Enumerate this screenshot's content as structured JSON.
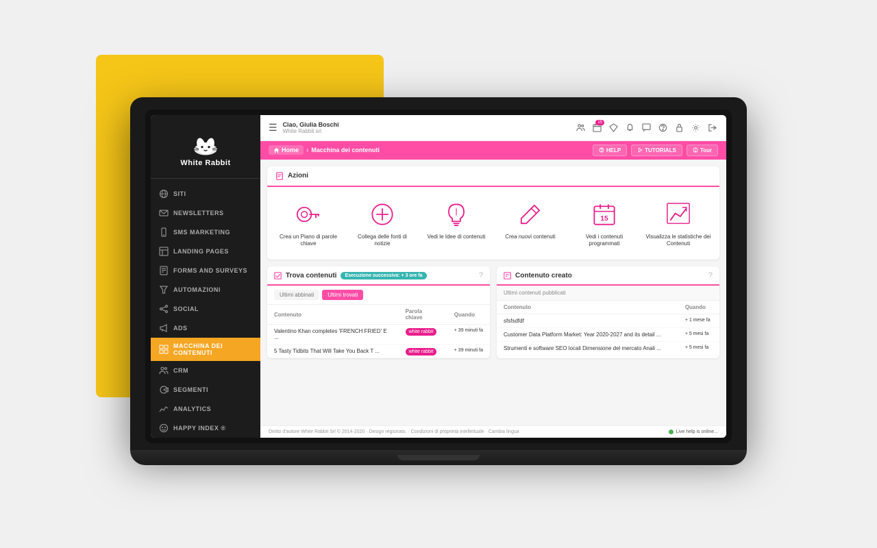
{
  "scene": {
    "yellow_bg": true
  },
  "sidebar": {
    "logo_text": "White Rabbit",
    "nav_items": [
      {
        "id": "siti",
        "label": "SITI",
        "icon": "globe"
      },
      {
        "id": "newsletters",
        "label": "NEWSLETTERS",
        "icon": "envelope"
      },
      {
        "id": "sms-marketing",
        "label": "SMS MARKETING",
        "icon": "device"
      },
      {
        "id": "landing-pages",
        "label": "LANDING PAGES",
        "icon": "layout"
      },
      {
        "id": "forms-surveys",
        "label": "FORMS AND SURVEYS",
        "icon": "form"
      },
      {
        "id": "automazioni",
        "label": "AUTOMAZIONI",
        "icon": "funnel"
      },
      {
        "id": "social",
        "label": "SOCIAL",
        "icon": "share"
      },
      {
        "id": "ads",
        "label": "ADS",
        "icon": "megaphone"
      },
      {
        "id": "macchina-contenuti",
        "label": "MACCHINA DEI CONTENUTI",
        "icon": "grid",
        "active": true
      },
      {
        "id": "crm",
        "label": "CRM",
        "icon": "users"
      },
      {
        "id": "segmenti",
        "label": "SEGMENTI",
        "icon": "segment"
      },
      {
        "id": "analytics",
        "label": "ANALYTICS",
        "icon": "chart"
      },
      {
        "id": "happy-index",
        "label": "HAPPY INDEX ®",
        "icon": "smile"
      }
    ]
  },
  "topbar": {
    "greeting": "Ciao, Giulia Boschi",
    "company": "White Rabbit srl",
    "badge_count": "15",
    "icons": [
      "users",
      "calendar",
      "diamond",
      "bell",
      "chat",
      "question",
      "lock",
      "settings",
      "exit"
    ]
  },
  "breadcrumb": {
    "home_label": "Home",
    "current_label": "Macchina dei contenuti",
    "help_label": "HELP",
    "tutorials_label": "TUTORIALS",
    "tour_label": "Tour"
  },
  "actions_card": {
    "header": "Azioni",
    "items": [
      {
        "id": "piano-parole",
        "label": "Crea un Piano di parole chiave",
        "icon": "key"
      },
      {
        "id": "collega-fonti",
        "label": "Collega delle fonti di notizie",
        "icon": "plus-circle"
      },
      {
        "id": "idee-contenuti",
        "label": "Vedi le Idee di contenuti",
        "icon": "lightbulb"
      },
      {
        "id": "nuovi-contenuti",
        "label": "Crea nuovi contenuti",
        "icon": "pencil"
      },
      {
        "id": "programmati",
        "label": "Vedi i contenuti programmati",
        "icon": "calendar-15"
      },
      {
        "id": "statistiche",
        "label": "Visualizza le statistiche dei Contenuti",
        "icon": "chart-up"
      }
    ]
  },
  "trova_contenuti": {
    "header": "Trova contenuti",
    "execution_badge": "Esecuzione successiva: + 3 ore fa",
    "tabs": [
      {
        "label": "Ultimi abbinati",
        "active": false
      },
      {
        "label": "Ultimi trovati",
        "active": true
      }
    ],
    "columns": [
      "Contenuto",
      "Parola chiave",
      "Quando"
    ],
    "rows": [
      {
        "content": "Valentino Khan completes 'FRENCH FRIED' E ...",
        "keyword": "white rabbit",
        "when": "+ 39 minuti fa"
      },
      {
        "content": "5 Tasty Tidbits That Will Take You Back T ...",
        "keyword": "white rabbit",
        "when": "+ 39 minuti fa"
      }
    ]
  },
  "contenuto_creato": {
    "header": "Contenuto creato",
    "sub_header": "Ultimi contenuti pubblicati",
    "columns": [
      "Contenuto",
      "Quando"
    ],
    "rows": [
      {
        "content": "sfsfsdfdf",
        "when": "+ 1 mese fa"
      },
      {
        "content": "Customer Data Platform Market: Year 2020-2027 and its detail ...",
        "when": "+ 5 mesi fa"
      },
      {
        "content": "Strumenti e software SEO locali Dimensione del mercato Anali ...",
        "when": "+ 5 mesi fa"
      }
    ]
  },
  "footer": {
    "copyright": "Diritto d'autore White Rabbit Srl © 2014-2020 · Design registrato. · Condizioni di proprietà intellettuale · Cambia lingua",
    "live_help": "Live help is online..."
  }
}
